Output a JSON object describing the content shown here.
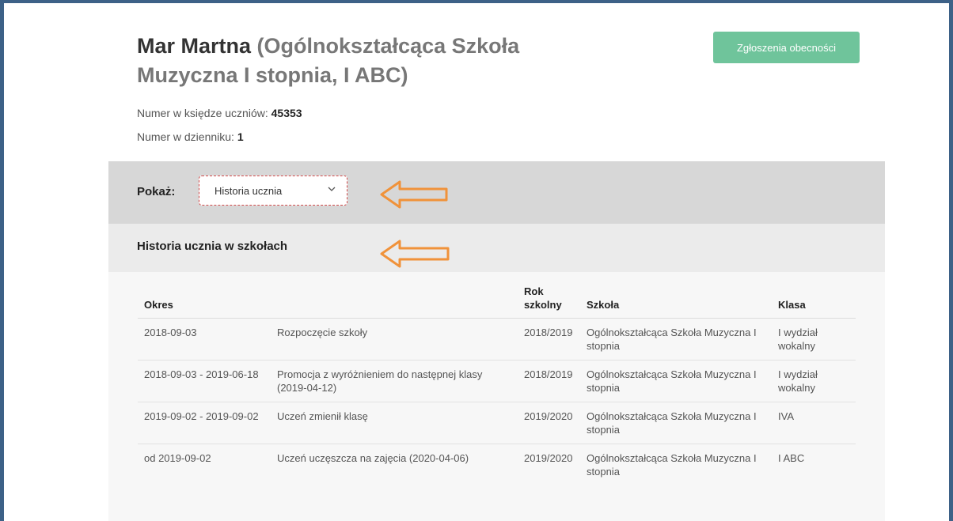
{
  "header": {
    "student_name": "Mar Martna",
    "school_line": "(Ogólnokształcąca Szkoła Muzyczna I stopnia, I ABC)",
    "attendance_button": "Zgłoszenia obecności"
  },
  "info": {
    "book_number_label": "Numer w księdze uczniów:",
    "book_number": "45353",
    "journal_number_label": "Numer w dzienniku:",
    "journal_number": "1"
  },
  "show": {
    "label": "Pokaż:",
    "selected": "Historia ucznia"
  },
  "history": {
    "title": "Historia ucznia w szkołach",
    "columns": [
      "Okres",
      "",
      "Rok szkolny",
      "Szkoła",
      "Klasa"
    ],
    "rows": [
      [
        "2018-09-03",
        "Rozpoczęcie szkoły",
        "2018/2019",
        "Ogólnokształcąca Szkoła Muzyczna I stopnia",
        "I wydział wokalny"
      ],
      [
        "2018-09-03 - 2019-06-18",
        "Promocja z wyróżnieniem do następnej klasy (2019-04-12)",
        "2018/2019",
        "Ogólnokształcąca Szkoła Muzyczna I stopnia",
        "I wydział wokalny"
      ],
      [
        "2019-09-02 - 2019-09-02",
        "Uczeń zmienił klasę",
        "2019/2020",
        "Ogólnokształcąca Szkoła Muzyczna I stopnia",
        "IVA"
      ],
      [
        "od 2019-09-02",
        "Uczeń uczęszcza na zajęcia (2020-04-06)",
        "2019/2020",
        "Ogólnokształcąca Szkoła Muzyczna I stopnia",
        "I ABC"
      ]
    ]
  },
  "annotations": {
    "arrow_color": "#f0923a",
    "icons": [
      "orange-arrow-left-icon",
      "chevron-down-icon"
    ]
  }
}
